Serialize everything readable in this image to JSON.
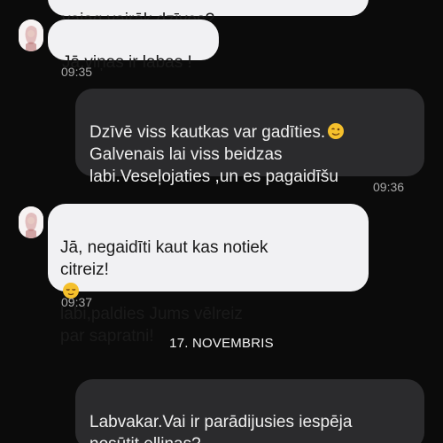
{
  "messages": [
    {
      "text": "vajag vairāk dzīves?"
    },
    {
      "text": "Jā,viņas ir labas !",
      "time": "09:35"
    },
    {
      "text": "Dzīvē viss kautkas var gadīties.",
      "text2": "Galvenais lai viss beidzas\nlabi.Veseļojaties ,un es pagaidīšu",
      "time": "09:36"
    },
    {
      "text": "Jā, negaidīti kaut kas notiek\ncitreiz!",
      "text2": "labi,paldies Jums vēlreiz\npar sapratni!",
      "time": "09:37"
    },
    {
      "text": "Labvakar.Vai ir parādijusies iespēja\nnosūtit eļļiņas?"
    }
  ],
  "date_separator": "17. NOVEMBRIS",
  "icons": {
    "avatar": "contact-avatar-icon",
    "emoji_wink": "winking-face-emoji",
    "emoji_relieved": "relieved-face-emoji"
  },
  "colors": {
    "background": "#0b0b0b",
    "incoming_bubble": "#f1f1f3",
    "outgoing_bubble": "#2b2b2d",
    "emoji": "#f5c02c"
  }
}
